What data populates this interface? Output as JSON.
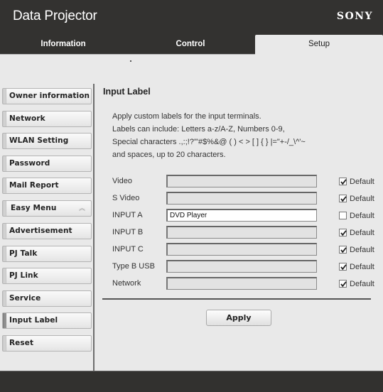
{
  "header": {
    "title": "Data Projector",
    "brand": "SONY"
  },
  "tabs": [
    {
      "label": "Information",
      "active": false
    },
    {
      "label": "Control",
      "active": false
    },
    {
      "label": "Setup",
      "active": true
    }
  ],
  "sidebar": {
    "items": [
      {
        "label": "Owner information",
        "active": false
      },
      {
        "label": "Network",
        "active": false
      },
      {
        "label": "WLAN Setting",
        "active": false
      },
      {
        "label": "Password",
        "active": false
      },
      {
        "label": "Mail Report",
        "active": false
      },
      {
        "label": "Easy Menu",
        "active": false,
        "icon": "double-chevron-up-icon",
        "icon_glyph": "︽"
      },
      {
        "label": "Advertisement",
        "active": false
      },
      {
        "label": "PJ Talk",
        "active": false
      },
      {
        "label": "PJ Link",
        "active": false
      },
      {
        "label": "Service",
        "active": false
      },
      {
        "label": "Input Label",
        "active": true
      },
      {
        "label": "Reset",
        "active": false
      }
    ]
  },
  "main": {
    "title": "Input Label",
    "description": [
      "Apply custom labels for the input terminals.",
      "Labels can include: Letters a-z/A-Z, Numbers 0-9,",
      "Special characters .,:;!?'\"#$%&@ ( ) < > [ ] { } |=\"+-/_\\^'~",
      "and spaces, up to 20 characters."
    ],
    "default_label": "Default",
    "inputs": [
      {
        "name": "Video",
        "value": "",
        "default": true
      },
      {
        "name": "S Video",
        "value": "",
        "default": true
      },
      {
        "name": "INPUT A",
        "value": "DVD Player",
        "default": false
      },
      {
        "name": "INPUT B",
        "value": "",
        "default": true
      },
      {
        "name": "INPUT C",
        "value": "",
        "default": true
      },
      {
        "name": "Type B USB",
        "value": "",
        "default": true
      },
      {
        "name": "Network",
        "value": "",
        "default": true
      }
    ],
    "apply_label": "Apply"
  }
}
